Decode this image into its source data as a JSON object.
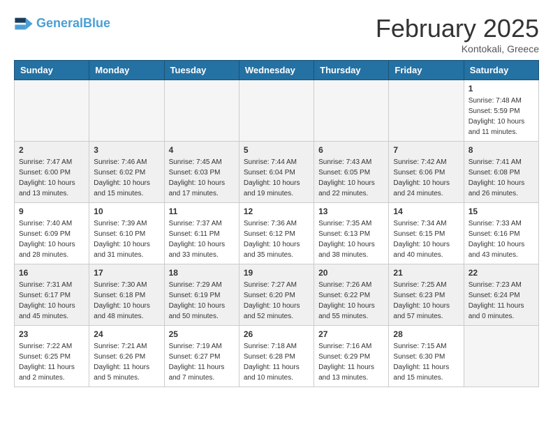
{
  "header": {
    "logo_line1": "General",
    "logo_line2": "Blue",
    "month_title": "February 2025",
    "location": "Kontokali, Greece"
  },
  "weekdays": [
    "Sunday",
    "Monday",
    "Tuesday",
    "Wednesday",
    "Thursday",
    "Friday",
    "Saturday"
  ],
  "weeks": [
    [
      {
        "day": "",
        "info": ""
      },
      {
        "day": "",
        "info": ""
      },
      {
        "day": "",
        "info": ""
      },
      {
        "day": "",
        "info": ""
      },
      {
        "day": "",
        "info": ""
      },
      {
        "day": "",
        "info": ""
      },
      {
        "day": "1",
        "info": "Sunrise: 7:48 AM\nSunset: 5:59 PM\nDaylight: 10 hours\nand 11 minutes."
      }
    ],
    [
      {
        "day": "2",
        "info": "Sunrise: 7:47 AM\nSunset: 6:00 PM\nDaylight: 10 hours\nand 13 minutes."
      },
      {
        "day": "3",
        "info": "Sunrise: 7:46 AM\nSunset: 6:02 PM\nDaylight: 10 hours\nand 15 minutes."
      },
      {
        "day": "4",
        "info": "Sunrise: 7:45 AM\nSunset: 6:03 PM\nDaylight: 10 hours\nand 17 minutes."
      },
      {
        "day": "5",
        "info": "Sunrise: 7:44 AM\nSunset: 6:04 PM\nDaylight: 10 hours\nand 19 minutes."
      },
      {
        "day": "6",
        "info": "Sunrise: 7:43 AM\nSunset: 6:05 PM\nDaylight: 10 hours\nand 22 minutes."
      },
      {
        "day": "7",
        "info": "Sunrise: 7:42 AM\nSunset: 6:06 PM\nDaylight: 10 hours\nand 24 minutes."
      },
      {
        "day": "8",
        "info": "Sunrise: 7:41 AM\nSunset: 6:08 PM\nDaylight: 10 hours\nand 26 minutes."
      }
    ],
    [
      {
        "day": "9",
        "info": "Sunrise: 7:40 AM\nSunset: 6:09 PM\nDaylight: 10 hours\nand 28 minutes."
      },
      {
        "day": "10",
        "info": "Sunrise: 7:39 AM\nSunset: 6:10 PM\nDaylight: 10 hours\nand 31 minutes."
      },
      {
        "day": "11",
        "info": "Sunrise: 7:37 AM\nSunset: 6:11 PM\nDaylight: 10 hours\nand 33 minutes."
      },
      {
        "day": "12",
        "info": "Sunrise: 7:36 AM\nSunset: 6:12 PM\nDaylight: 10 hours\nand 35 minutes."
      },
      {
        "day": "13",
        "info": "Sunrise: 7:35 AM\nSunset: 6:13 PM\nDaylight: 10 hours\nand 38 minutes."
      },
      {
        "day": "14",
        "info": "Sunrise: 7:34 AM\nSunset: 6:15 PM\nDaylight: 10 hours\nand 40 minutes."
      },
      {
        "day": "15",
        "info": "Sunrise: 7:33 AM\nSunset: 6:16 PM\nDaylight: 10 hours\nand 43 minutes."
      }
    ],
    [
      {
        "day": "16",
        "info": "Sunrise: 7:31 AM\nSunset: 6:17 PM\nDaylight: 10 hours\nand 45 minutes."
      },
      {
        "day": "17",
        "info": "Sunrise: 7:30 AM\nSunset: 6:18 PM\nDaylight: 10 hours\nand 48 minutes."
      },
      {
        "day": "18",
        "info": "Sunrise: 7:29 AM\nSunset: 6:19 PM\nDaylight: 10 hours\nand 50 minutes."
      },
      {
        "day": "19",
        "info": "Sunrise: 7:27 AM\nSunset: 6:20 PM\nDaylight: 10 hours\nand 52 minutes."
      },
      {
        "day": "20",
        "info": "Sunrise: 7:26 AM\nSunset: 6:22 PM\nDaylight: 10 hours\nand 55 minutes."
      },
      {
        "day": "21",
        "info": "Sunrise: 7:25 AM\nSunset: 6:23 PM\nDaylight: 10 hours\nand 57 minutes."
      },
      {
        "day": "22",
        "info": "Sunrise: 7:23 AM\nSunset: 6:24 PM\nDaylight: 11 hours\nand 0 minutes."
      }
    ],
    [
      {
        "day": "23",
        "info": "Sunrise: 7:22 AM\nSunset: 6:25 PM\nDaylight: 11 hours\nand 2 minutes."
      },
      {
        "day": "24",
        "info": "Sunrise: 7:21 AM\nSunset: 6:26 PM\nDaylight: 11 hours\nand 5 minutes."
      },
      {
        "day": "25",
        "info": "Sunrise: 7:19 AM\nSunset: 6:27 PM\nDaylight: 11 hours\nand 7 minutes."
      },
      {
        "day": "26",
        "info": "Sunrise: 7:18 AM\nSunset: 6:28 PM\nDaylight: 11 hours\nand 10 minutes."
      },
      {
        "day": "27",
        "info": "Sunrise: 7:16 AM\nSunset: 6:29 PM\nDaylight: 11 hours\nand 13 minutes."
      },
      {
        "day": "28",
        "info": "Sunrise: 7:15 AM\nSunset: 6:30 PM\nDaylight: 11 hours\nand 15 minutes."
      },
      {
        "day": "",
        "info": ""
      }
    ]
  ]
}
